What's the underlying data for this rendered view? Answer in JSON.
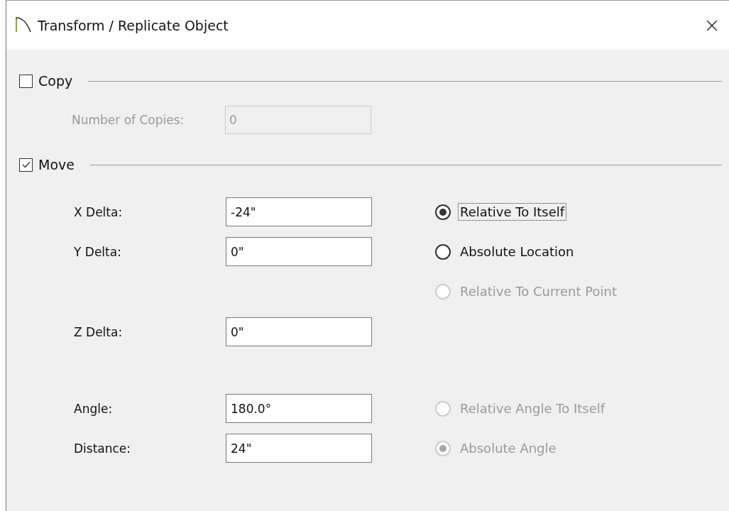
{
  "window": {
    "title": "Transform / Replicate Object",
    "close": "×"
  },
  "copy": {
    "label": "Copy",
    "checked": false,
    "count_label": "Number of Copies:",
    "count_value": "0",
    "disabled": true
  },
  "move": {
    "label": "Move",
    "checked": true,
    "groups": [
      [
        {
          "field": {
            "label": "X Delta:",
            "value": "-24\""
          },
          "option": {
            "label": "Relative To Itself",
            "selected": true,
            "disabled": false,
            "focused": true
          }
        },
        {
          "field": {
            "label": "Y Delta:",
            "value": "0\""
          },
          "option": {
            "label": "Absolute Location",
            "selected": false,
            "disabled": false,
            "focused": false
          }
        },
        {
          "option": {
            "label": "Relative To Current Point",
            "selected": false,
            "disabled": true,
            "focused": false
          }
        }
      ],
      [
        {
          "field": {
            "label": "Z Delta:",
            "value": "0\""
          }
        }
      ],
      [
        {
          "field": {
            "label": "Angle:",
            "value": "180.0°"
          },
          "option": {
            "label": "Relative Angle To Itself",
            "selected": false,
            "disabled": true,
            "focused": false
          }
        },
        {
          "field": {
            "label": "Distance:",
            "value": "24\""
          },
          "option": {
            "label": "Absolute Angle",
            "selected": true,
            "disabled": true,
            "focused": false
          }
        }
      ]
    ]
  }
}
